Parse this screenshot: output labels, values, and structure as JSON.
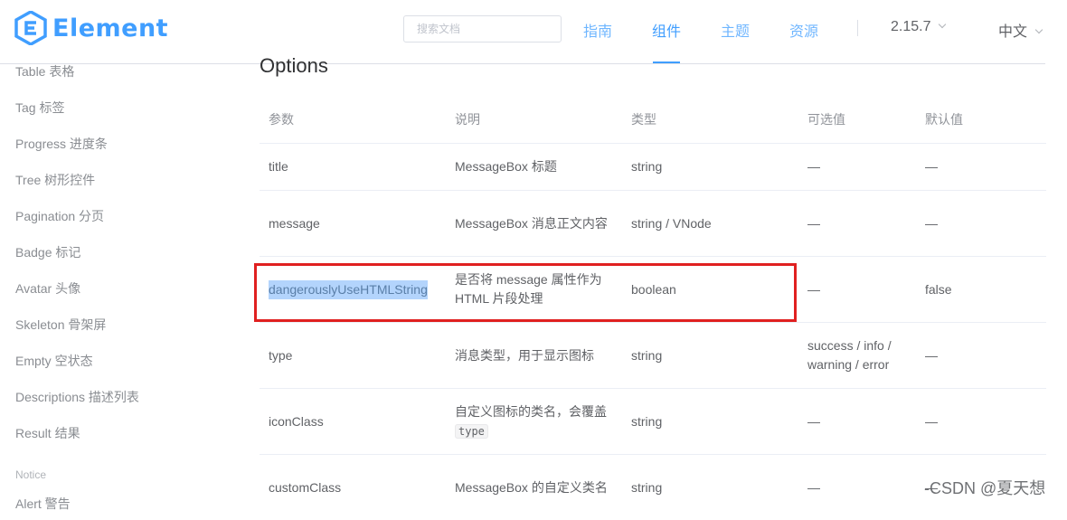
{
  "header": {
    "logo_text": "Element",
    "search_placeholder": "搜索文档",
    "nav": [
      "指南",
      "组件",
      "主题",
      "资源"
    ],
    "active_nav": "组件",
    "version": "2.15.7",
    "language": "中文",
    "accent_color": "#409eff"
  },
  "sidebar": {
    "items": [
      "Table 表格",
      "Tag 标签",
      "Progress 进度条",
      "Tree 树形控件",
      "Pagination 分页",
      "Badge 标记",
      "Avatar 头像",
      "Skeleton 骨架屏",
      "Empty 空状态",
      "Descriptions 描述列表",
      "Result 结果"
    ],
    "group_label": "Notice",
    "partial_item": "Alert 警告"
  },
  "main": {
    "section_title": "Options",
    "columns": [
      "参数",
      "说明",
      "类型",
      "可选值",
      "默认值"
    ],
    "rows": [
      {
        "param": "title",
        "desc": "MessageBox 标题",
        "type": "string",
        "options": "—",
        "default": "—"
      },
      {
        "param": "message",
        "desc": "MessageBox 消息正文内容",
        "type": "string / VNode",
        "options": "—",
        "default": "—"
      },
      {
        "param": "dangerouslyUseHTMLString",
        "desc": "是否将 message 属性作为 HTML 片段处理",
        "type": "boolean",
        "options": "—",
        "default": "false"
      },
      {
        "param": "type",
        "desc": "消息类型，用于显示图标",
        "type": "string",
        "options": "success / info / warning / error",
        "default": "—"
      },
      {
        "param": "iconClass",
        "desc_prefix": "自定义图标的类名，会覆盖 ",
        "desc_code": "type",
        "type": "string",
        "options": "—",
        "default": "—"
      },
      {
        "param": "customClass",
        "desc": "MessageBox 的自定义类名",
        "type": "string",
        "options": "—",
        "default": "—"
      }
    ]
  },
  "watermark": "-CSDN @夏天想"
}
